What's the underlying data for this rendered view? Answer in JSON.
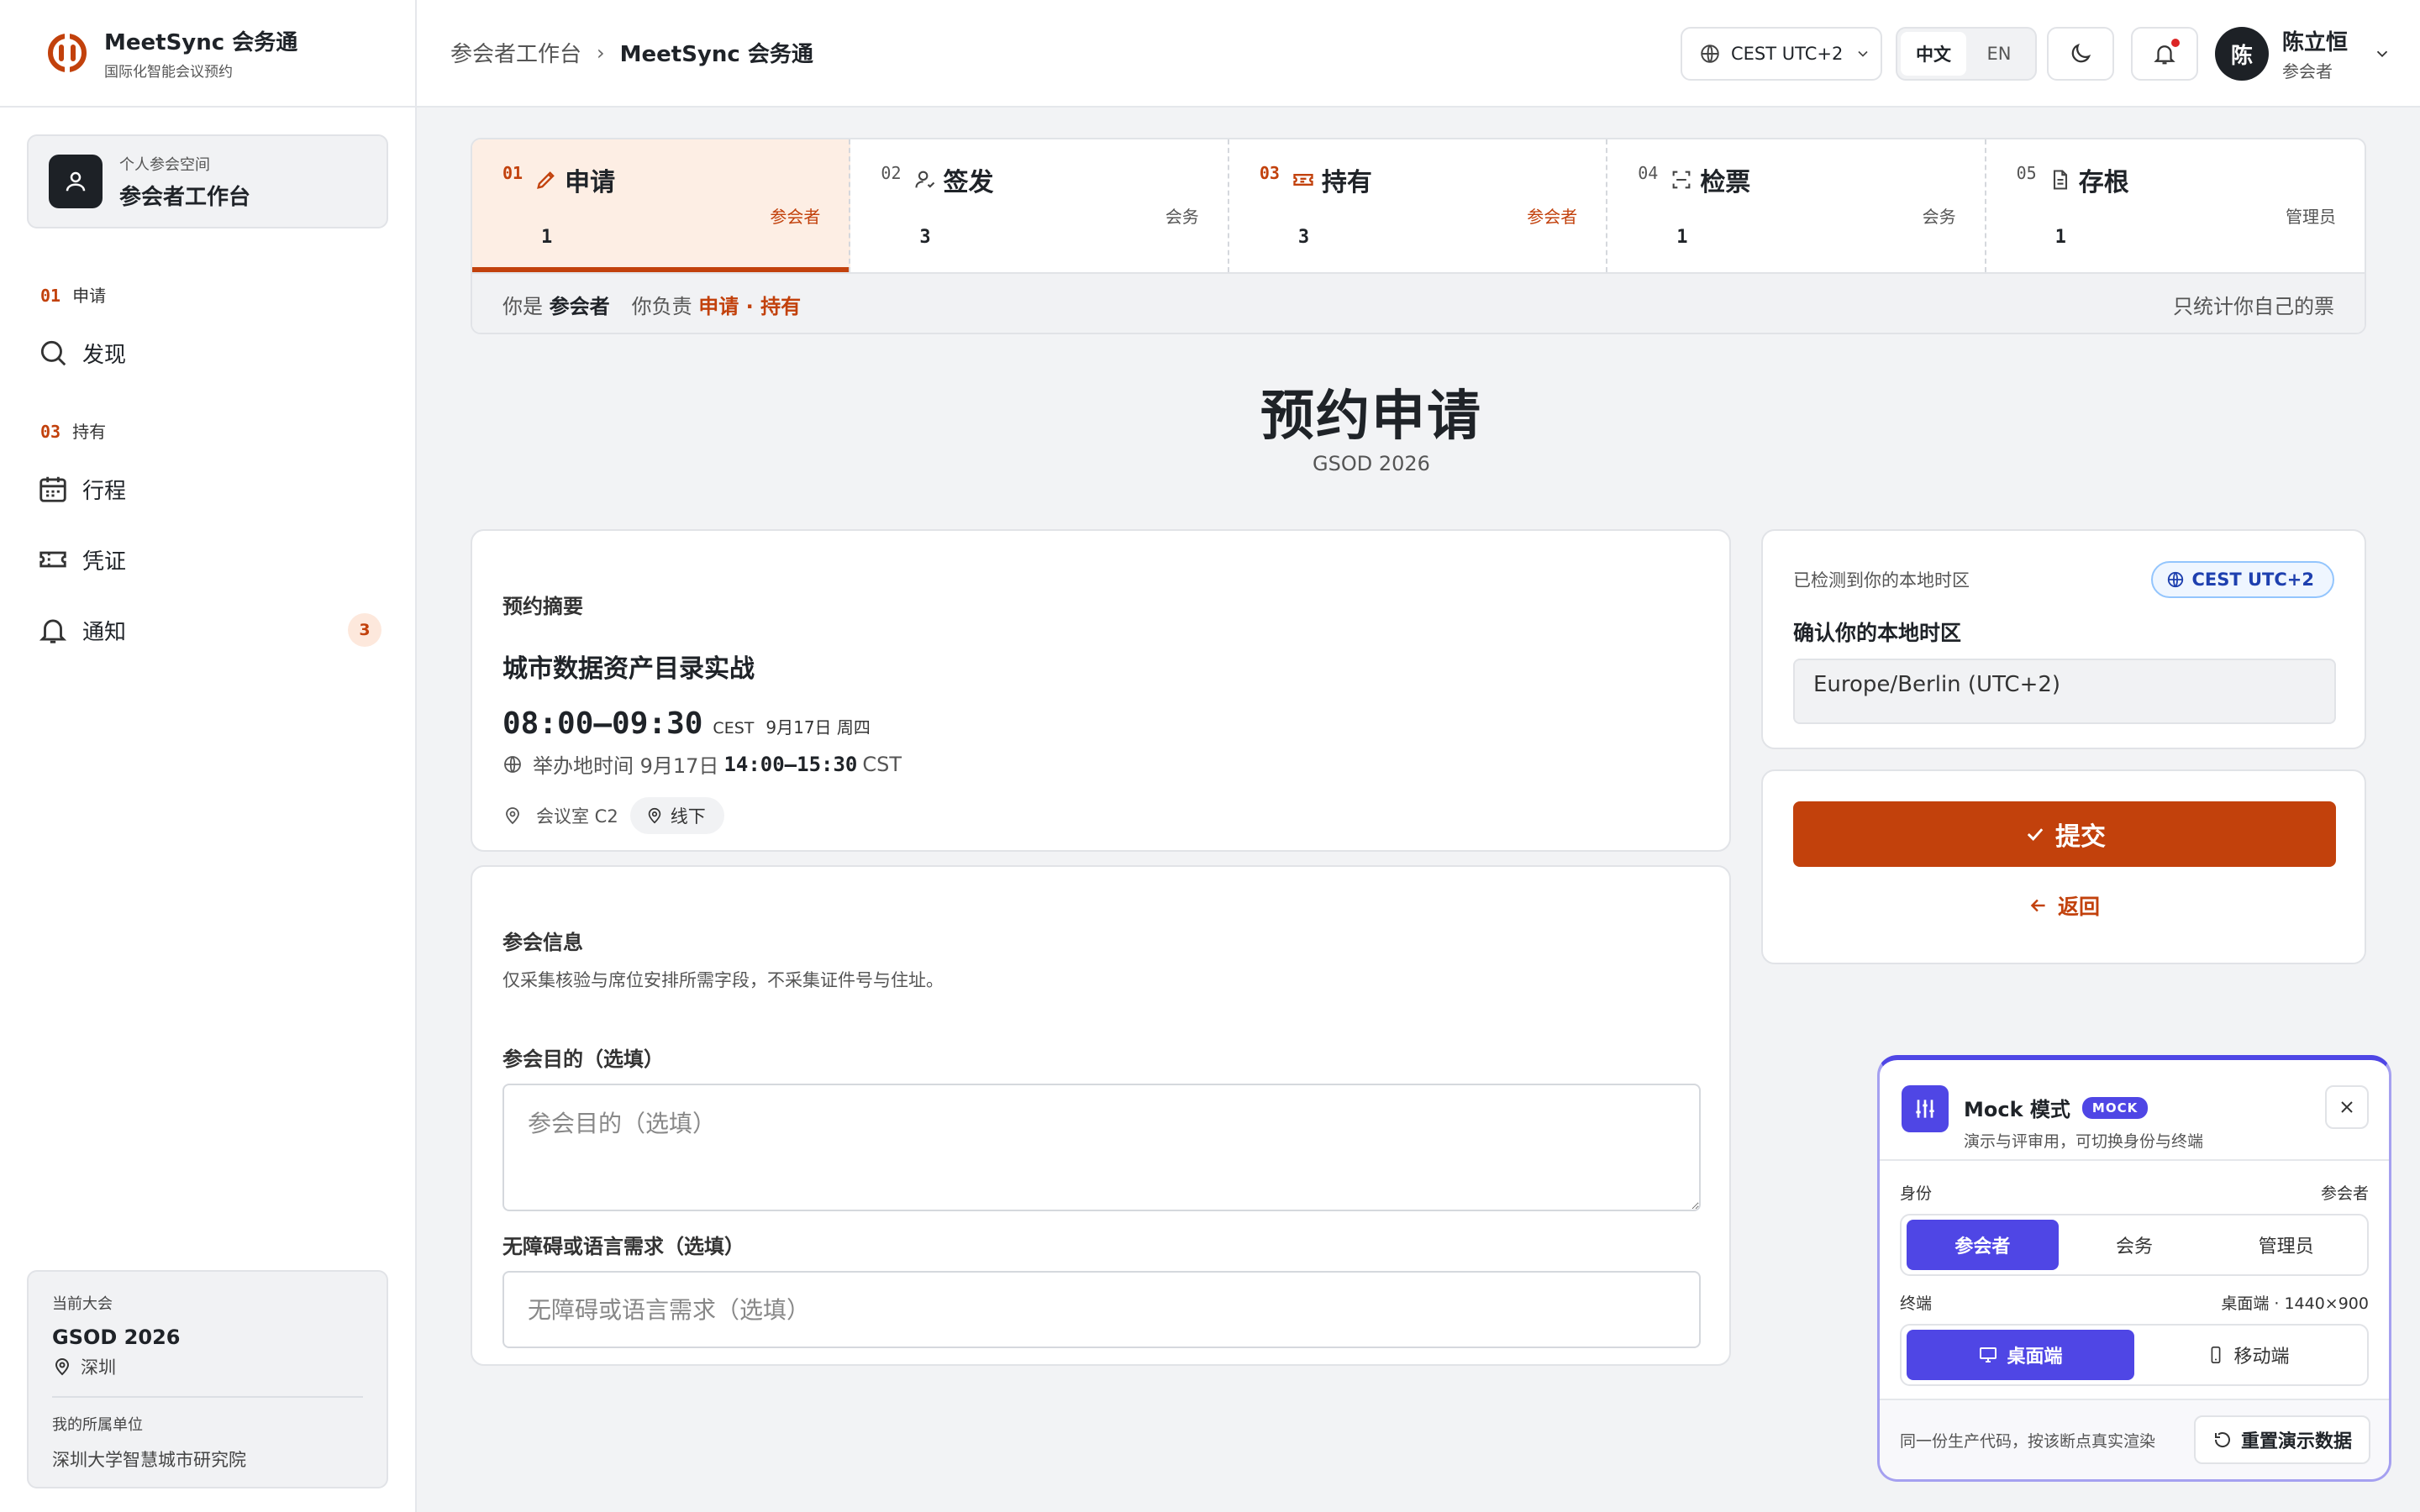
{
  "brand": {
    "name": "MeetSync 会务通",
    "subtitle": "国际化智能会议预约"
  },
  "sidebar": {
    "workspace": {
      "subtitle": "个人参会空间",
      "title": "参会者工作台"
    },
    "sections": [
      {
        "num": "01",
        "label": "申请",
        "items": [
          {
            "label": "发现",
            "icon": "search-icon"
          }
        ]
      },
      {
        "num": "03",
        "label": "持有",
        "items": [
          {
            "label": "行程",
            "icon": "calendar-icon"
          },
          {
            "label": "凭证",
            "icon": "ticket-icon"
          },
          {
            "label": "通知",
            "icon": "bell-icon",
            "badge": "3"
          }
        ]
      }
    ],
    "conference": {
      "label": "当前大会",
      "name": "GSOD 2026",
      "location": "深圳",
      "org_label": "我的所属单位",
      "org": "深圳大学智慧城市研究院"
    }
  },
  "header": {
    "breadcrumb": {
      "parent": "参会者工作台",
      "separator": "›",
      "current": "MeetSync 会务通"
    },
    "timezone": "CEST UTC+2",
    "languages": {
      "zh": "中文",
      "en": "EN",
      "active": "zh"
    },
    "user": {
      "initial": "陈",
      "name": "陈立恒",
      "role": "参会者"
    }
  },
  "stepper": {
    "steps": [
      {
        "num": "01",
        "label": "申请",
        "role": "参会者",
        "count": "1",
        "icon": "pencil-icon",
        "active": true,
        "highlight": true
      },
      {
        "num": "02",
        "label": "签发",
        "role": "会务",
        "count": "3",
        "icon": "user-check-icon",
        "active": false,
        "highlight": false
      },
      {
        "num": "03",
        "label": "持有",
        "role": "参会者",
        "count": "3",
        "icon": "ticket-icon",
        "active": false,
        "highlight": true
      },
      {
        "num": "04",
        "label": "检票",
        "role": "会务",
        "count": "1",
        "icon": "scan-icon",
        "active": false,
        "highlight": false
      },
      {
        "num": "05",
        "label": "存根",
        "role": "管理员",
        "count": "1",
        "icon": "file-icon",
        "active": false,
        "highlight": false
      }
    ],
    "role_bar": {
      "you_are": "你是",
      "role": "参会者",
      "responsible": "你负责",
      "duties": "申请 · 持有",
      "note": "只统计你自己的票"
    }
  },
  "page": {
    "title": "预约申请",
    "subtitle": "GSOD 2026"
  },
  "summary": {
    "section_title": "预约摘要",
    "session_title": "城市数据资产目录实战",
    "local_time": "08:00–09:30",
    "local_tz": "CEST",
    "local_date": "9月17日 周四",
    "host_prefix": "举办地时间 9月17日",
    "host_time": "14:00–15:30",
    "host_tz": "CST",
    "room": "会议室 C2",
    "mode": "线下"
  },
  "info": {
    "section_title": "参会信息",
    "note": "仅采集核验与席位安排所需字段，不采集证件号与住址。",
    "purpose_label": "参会目的（选填）",
    "purpose_placeholder": "参会目的（选填）",
    "access_label": "无障碍或语言需求（选填）",
    "access_placeholder": "无障碍或语言需求（选填）"
  },
  "tz_card": {
    "detected_label": "已检测到你的本地时区",
    "detected_value": "CEST UTC+2",
    "confirm_label": "确认你的本地时区",
    "selected": "Europe/Berlin (UTC+2)"
  },
  "actions": {
    "submit": "提交",
    "back": "返回"
  },
  "mock": {
    "title": "Mock 模式",
    "badge": "MOCK",
    "subtitle": "演示与评审用，可切换身份与终端",
    "identity_label": "身份",
    "identity_value": "参会者",
    "identities": [
      "参会者",
      "会务",
      "管理员"
    ],
    "terminal_label": "终端",
    "terminal_value": "桌面端 · 1440×900",
    "terminals": [
      "桌面端",
      "移动端"
    ],
    "footer_note": "同一份生产代码，按该断点真实渲染",
    "reset": "重置演示数据"
  },
  "colors": {
    "accent": "#c2410c",
    "mock_accent": "#4f46e5",
    "info_blue": "#1e40af"
  }
}
